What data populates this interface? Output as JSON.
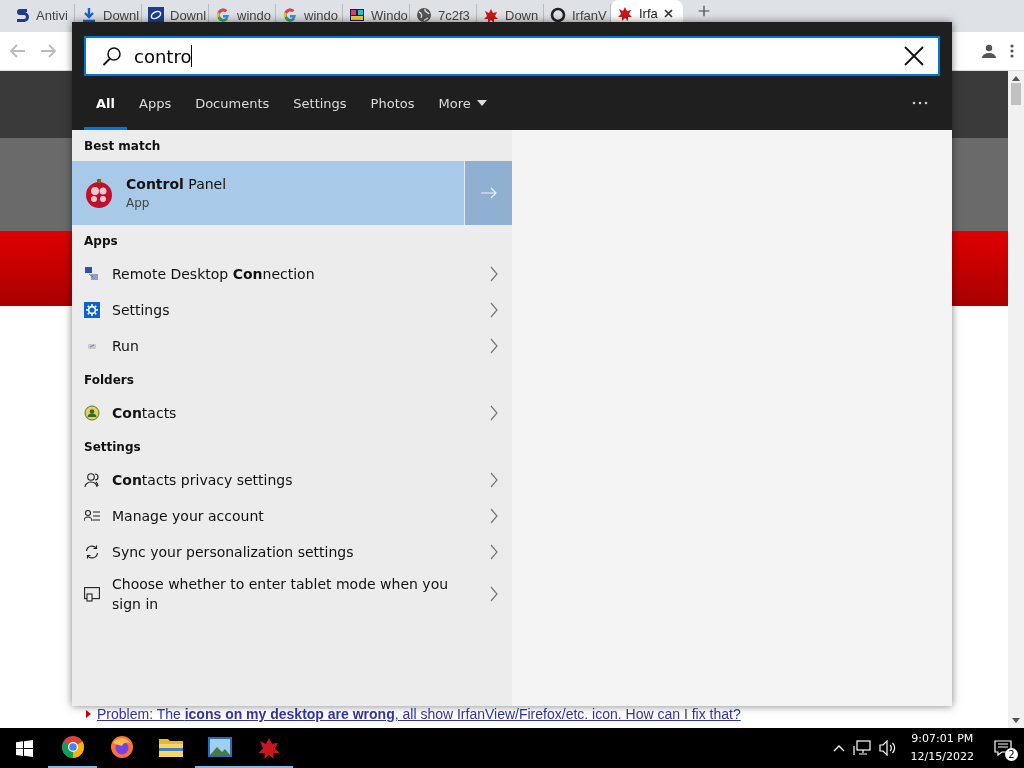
{
  "browser": {
    "tabs": [
      {
        "label": "Antivi",
        "kind": "s-logo",
        "selected": false
      },
      {
        "label": "Downl",
        "kind": "download",
        "selected": false
      },
      {
        "label": "Downl",
        "kind": "badge",
        "selected": false
      },
      {
        "label": "windo",
        "kind": "google",
        "selected": false
      },
      {
        "label": "windo",
        "kind": "google",
        "selected": false
      },
      {
        "label": "Windo",
        "kind": "tiles",
        "selected": false
      },
      {
        "label": "7c2f3",
        "kind": "globe",
        "selected": false
      },
      {
        "label": "Down",
        "kind": "bug",
        "selected": false
      },
      {
        "label": "IrfanV",
        "kind": "ring",
        "selected": false
      },
      {
        "label": "Irfa",
        "kind": "bug",
        "selected": true
      }
    ],
    "page_link": "Problem: The **icons on my desktop are wrong**, all show IrfanView/Firefox/etc. icon. How can I fix that?"
  },
  "search": {
    "query": "contro",
    "scopes": [
      {
        "label": "All",
        "kind": "plain",
        "selected": true
      },
      {
        "label": "Apps",
        "kind": "plain",
        "selected": false
      },
      {
        "label": "Documents",
        "kind": "plain",
        "selected": false
      },
      {
        "label": "Settings",
        "kind": "plain",
        "selected": false
      },
      {
        "label": "Photos",
        "kind": "plain",
        "selected": false
      },
      {
        "label": "More",
        "kind": "dropdown",
        "selected": false
      }
    ],
    "groups": [
      {
        "heading": "Best match",
        "items": [
          {
            "title": "**Control** Panel",
            "subtitle": "App",
            "kind": "control-panel",
            "selected": true
          }
        ]
      },
      {
        "heading": "Apps",
        "items": [
          {
            "title": "Remote Desktop **Con**nection",
            "kind": "remote-desktop",
            "selected": false
          },
          {
            "title": "Settings",
            "kind": "settings",
            "selected": false
          },
          {
            "title": "Run",
            "kind": "run",
            "selected": false
          }
        ]
      },
      {
        "heading": "Folders",
        "items": [
          {
            "title": "**Con**tacts",
            "kind": "contacts-folder",
            "selected": false
          }
        ]
      },
      {
        "heading": "Settings",
        "items": [
          {
            "title": "**Con**tacts privacy settings",
            "kind": "person",
            "selected": false
          },
          {
            "title": "Manage your account",
            "kind": "account",
            "selected": false
          },
          {
            "title": "Sync your personalization settings",
            "kind": "sync",
            "selected": false
          },
          {
            "title": "Choose whether to enter tablet mode when you sign in",
            "kind": "tablet",
            "selected": false
          }
        ]
      }
    ]
  },
  "taskbar": {
    "apps": [
      {
        "kind": "chrome",
        "running": true
      },
      {
        "kind": "firefox",
        "running": false
      },
      {
        "kind": "folder",
        "running": false
      },
      {
        "kind": "photo",
        "running": true
      },
      {
        "kind": "bug",
        "running": true
      }
    ],
    "time": "9:07:01 PM",
    "date": "12/15/2022",
    "notifications": "2"
  }
}
